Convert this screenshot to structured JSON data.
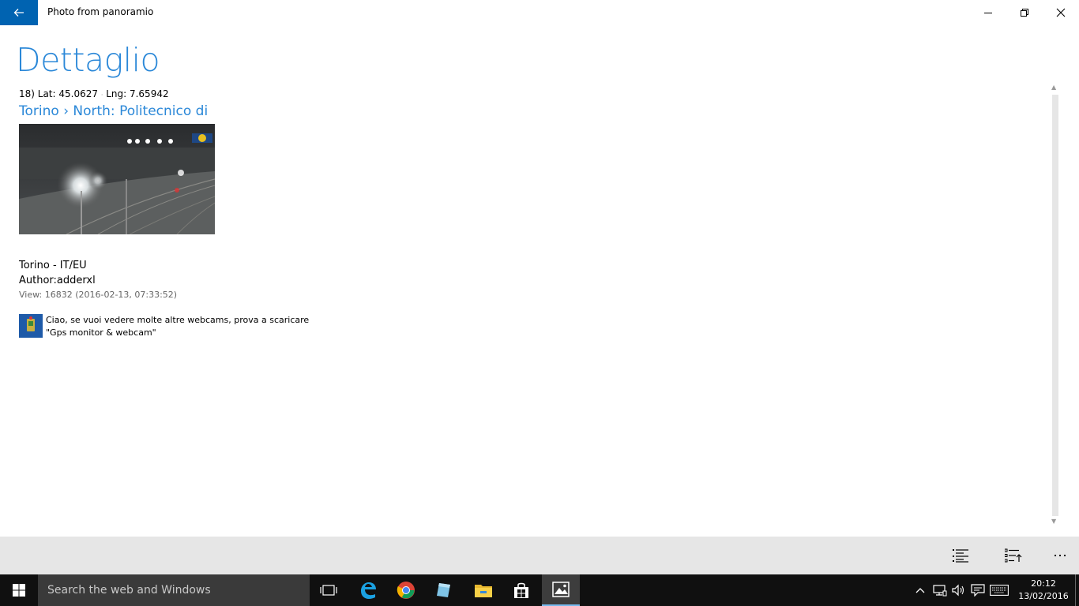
{
  "window": {
    "title": "Photo from panoramio",
    "icons": [
      "back-arrow-icon",
      "minimize-icon",
      "restore-icon",
      "close-icon"
    ]
  },
  "page": {
    "title": "Dettaglio",
    "coords_prefix": "18) Lat: 45.0627",
    "coords_separator": "·",
    "coords_lng": "Lng: 7.65942",
    "place_link": "Torino › North: Politecnico di",
    "location": "Torino - IT/EU",
    "author": "Author:adderxl",
    "views": "View: 16832 (2016-02-13, 07:33:52)",
    "comment_line1": "Ciao, se vuoi vedere molte altre webcams, prova a scaricare",
    "comment_line2": "\"Gps monitor & webcam\""
  },
  "cmdbar": {
    "icons": [
      "list-icon",
      "list-sort-icon",
      "more-icon"
    ]
  },
  "taskbar": {
    "search_placeholder": "Search the web and Windows",
    "apps": [
      "task-view-icon",
      "edge-icon",
      "chrome-icon",
      "app-icon",
      "file-explorer-icon",
      "store-icon",
      "photos-icon"
    ],
    "tray": [
      "chevron-up-icon",
      "network-icon",
      "volume-icon",
      "notifications-icon",
      "keyboard-icon"
    ],
    "time": "20:12",
    "date": "13/02/2016"
  },
  "colors": {
    "accent": "#0063b1",
    "link": "#2b88d8",
    "taskbar": "#101010",
    "cmdbar": "#e6e6e6"
  }
}
